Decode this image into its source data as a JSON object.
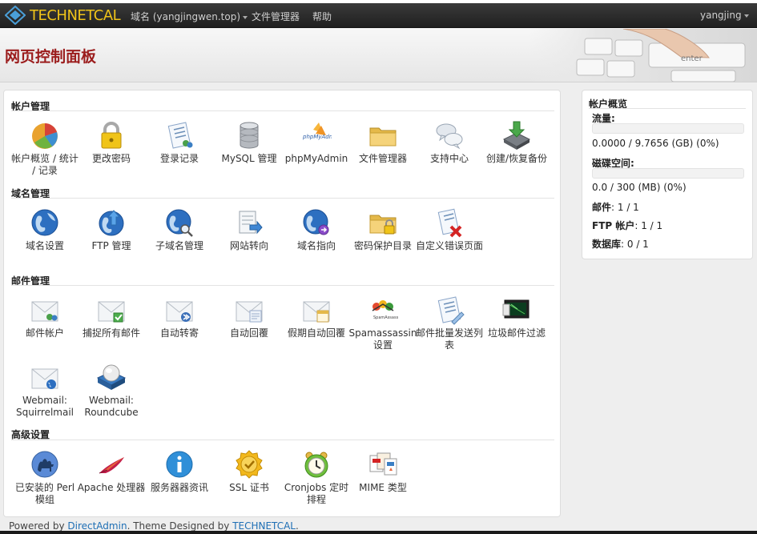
{
  "navbar": {
    "brand": "TECHNETCAL",
    "domain_menu": "域名 (yangjingwen.top)",
    "file_manager": "文件管理器",
    "help": "帮助",
    "user": "yangjing"
  },
  "header": {
    "title": "网页控制面板"
  },
  "sections": {
    "account": {
      "title": "帐户管理",
      "items": [
        "帐户概览 / 统计 / 记录",
        "更改密码",
        "登录记录",
        "MySQL 管理",
        "phpMyAdmin",
        "文件管理器",
        "支持中心",
        "创建/恢复备份"
      ]
    },
    "domain": {
      "title": "域名管理",
      "items": [
        "域名设置",
        "FTP 管理",
        "子域名管理",
        "网站转向",
        "域名指向",
        "密码保护目录",
        "自定义错误页面"
      ]
    },
    "mail": {
      "title": "邮件管理",
      "items": [
        "邮件帐户",
        "捕捉所有邮件",
        "自动转寄",
        "自动回覆",
        "假期自动回覆",
        "Spamassassin 设置",
        "邮件批量发送列表",
        "垃圾邮件过滤",
        "Webmail: Squirrelmail",
        "Webmail: Roundcube"
      ]
    },
    "advanced": {
      "title": "高级设置",
      "items": [
        "已安装的 Perl 模组",
        "Apache 处理器",
        "服务器器资讯",
        "SSL 证书",
        "Cronjobs 定时排程",
        "MIME 类型"
      ]
    }
  },
  "overview": {
    "title": "帐户概览",
    "bandwidth_label": "流量:",
    "bandwidth_value": "0.0000 / 9.7656 (GB) (0%)",
    "bandwidth_percent": 0,
    "disk_label": "磁碟空间:",
    "disk_value": "0.0 / 300 (MB) (0%)",
    "disk_percent": 0,
    "email_label": "邮件",
    "email_value": ": 1 / 1",
    "ftp_label": "FTP 帐户",
    "ftp_value": ": 1 / 1",
    "db_label": "数据库",
    "db_value": ": 0 / 1"
  },
  "footer": {
    "powered_by": "Powered by ",
    "directadmin": "DirectAdmin",
    "theme_text": ". Theme Designed by ",
    "technetcal": "TECHNETCAL",
    "end": "."
  },
  "colors": {
    "title_red": "#9b1c1c",
    "brand_yellow": "#f0c419",
    "link_blue": "#1e6fb5"
  }
}
